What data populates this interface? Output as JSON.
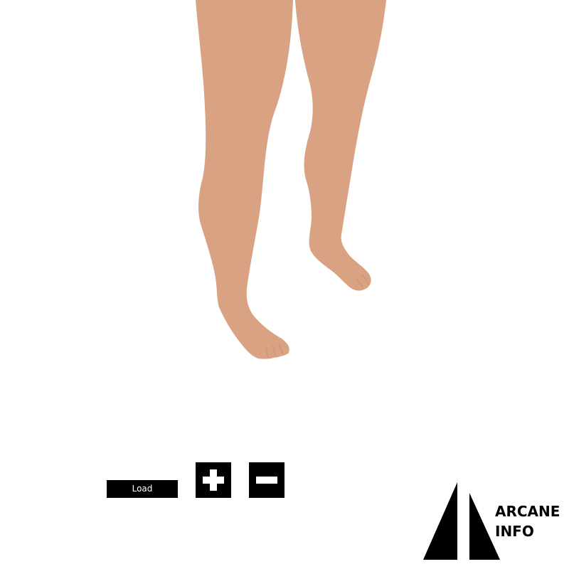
{
  "viewer": {
    "skin_color": "#d8a283",
    "background_color": "#ffffff"
  },
  "controls": {
    "load_label": "Load",
    "zoom_in_icon": "plus-icon",
    "zoom_out_icon": "minus-icon"
  },
  "logo": {
    "line1": "ARCANE",
    "line2": "INFO"
  }
}
